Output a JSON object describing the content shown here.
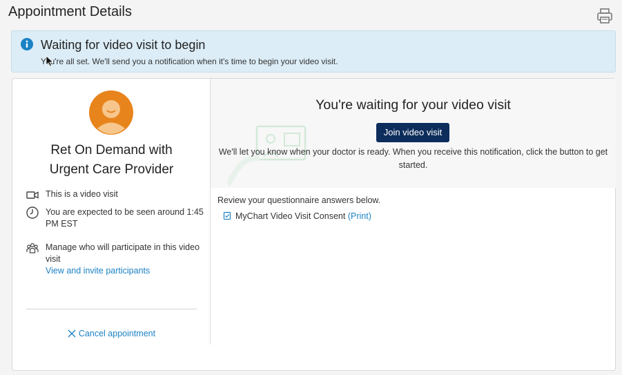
{
  "page": {
    "title": "Appointment Details",
    "print_icon": "printer-icon"
  },
  "banner": {
    "icon": "info-icon",
    "title": "Waiting for video visit to begin",
    "subtitle": "You're all set. We'll send you a notification when it's time to begin your video visit.",
    "color": "#dcedf7"
  },
  "provider": {
    "line1": "Ret On Demand with",
    "line2": "Urgent Care Provider",
    "avatar_color": "#e8841c"
  },
  "details": {
    "video_visit": "This is a video visit",
    "expected_time": "You are expected to be seen around 1:45 PM EST",
    "manage_participants": "Manage who will participate in this video visit",
    "invite_link": "View and invite participants",
    "cancel": "Cancel appointment"
  },
  "waiting": {
    "title": "You're waiting for your video visit",
    "join_button": "Join video visit",
    "description": "We'll let you know when your doctor is ready. When you receive this notification, click the button to get started.",
    "join_button_color": "#0d2e5c"
  },
  "questionnaire": {
    "review_text": "Review your questionnaire answers below.",
    "consent_name": "MyChart Video Visit Consent",
    "print_link": "(Print)"
  },
  "colors": {
    "link": "#1b82c4"
  }
}
